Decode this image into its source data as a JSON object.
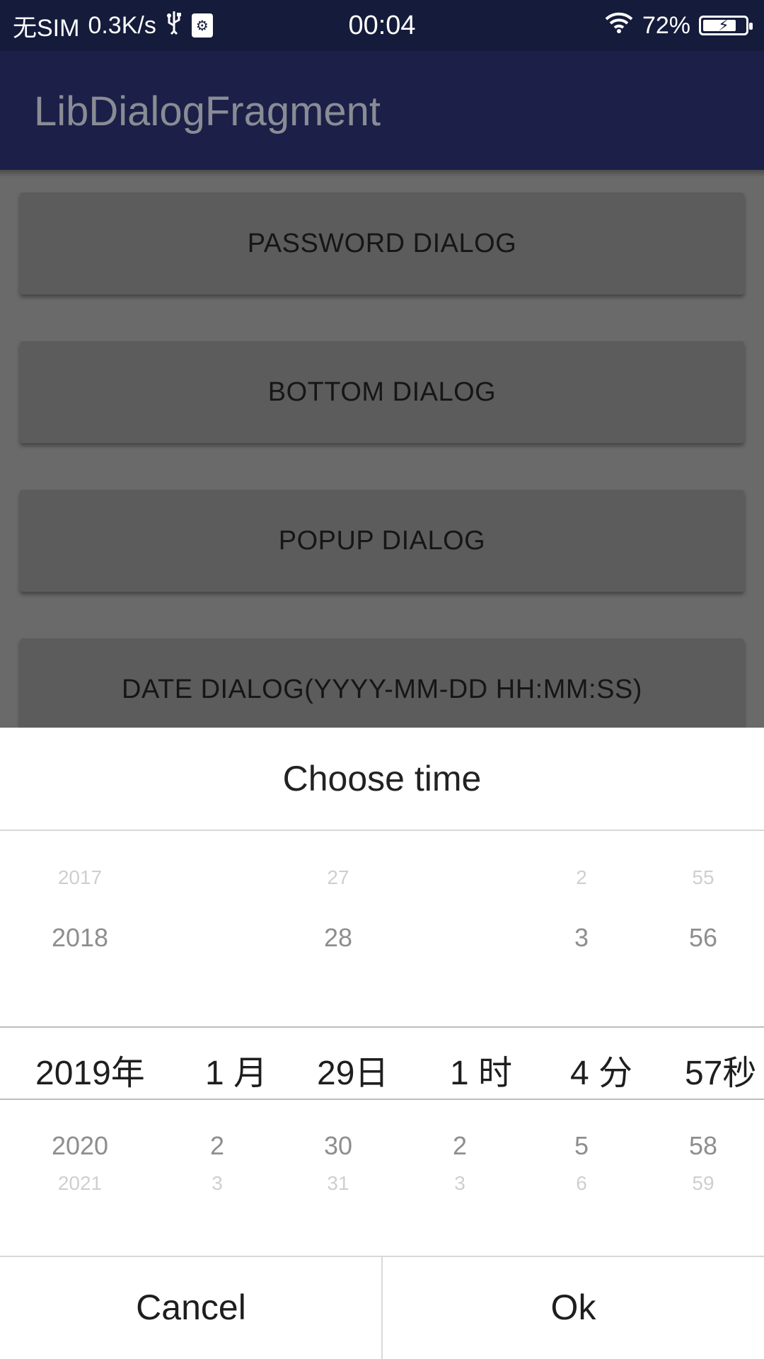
{
  "status_bar": {
    "carrier": "无SIM",
    "speed": "0.3K/s",
    "time": "00:04",
    "battery": "72%"
  },
  "app_bar": {
    "title": "LibDialogFragment"
  },
  "buttons": [
    "PASSWORD DIALOG",
    "BOTTOM DIALOG",
    "POPUP DIALOG",
    "DATE DIALOG(YYYY-MM-DD HH:MM:SS)"
  ],
  "dialog": {
    "title": "Choose time",
    "columns": [
      {
        "name": "year",
        "above": [
          "2017",
          "2018"
        ],
        "selected": "2019年",
        "below": [
          "2020",
          "2021"
        ]
      },
      {
        "name": "month",
        "above": [
          "",
          ""
        ],
        "selected": "1 月",
        "below": [
          "2",
          "3"
        ]
      },
      {
        "name": "day",
        "above": [
          "27",
          "28"
        ],
        "selected": "29日",
        "below": [
          "30",
          "31"
        ]
      },
      {
        "name": "hour",
        "above": [
          "",
          ""
        ],
        "selected": "1 时",
        "below": [
          "2",
          "3"
        ]
      },
      {
        "name": "minute",
        "above": [
          "2",
          "3"
        ],
        "selected": "4 分",
        "below": [
          "5",
          "6"
        ]
      },
      {
        "name": "second",
        "above": [
          "55",
          "56"
        ],
        "selected": "57秒",
        "below": [
          "58",
          "59"
        ]
      }
    ],
    "cancel_label": "Cancel",
    "ok_label": "Ok"
  },
  "colors": {
    "status_bar": "#151b3a",
    "app_bar": "#1c2048",
    "overlay_bg": "#6a6a6a",
    "button_bg": "#5c5c5c"
  }
}
